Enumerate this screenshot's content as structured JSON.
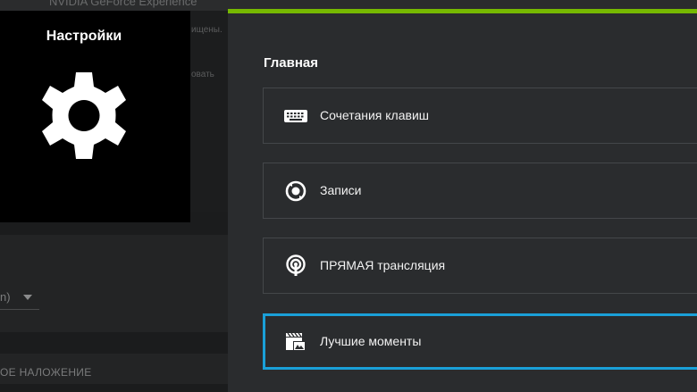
{
  "background": {
    "window_title": "NVIDIA GeForce Experience",
    "text_fragment_1": "ищены.",
    "text_fragment_2": "овать",
    "dropdown_value_fragment": "n)",
    "overlay_section_label": "ОЕ НАЛОЖЕНИЕ"
  },
  "settings_tile": {
    "title": "Настройки",
    "icon": "gear-icon"
  },
  "panel": {
    "accent_color": "#76b900",
    "selected_border_color": "#1aa0d8",
    "section_title": "Главная",
    "items": [
      {
        "label": "Сочетания клавиш",
        "icon": "keyboard-icon",
        "selected": false
      },
      {
        "label": "Записи",
        "icon": "record-icon",
        "selected": false
      },
      {
        "label": "ПРЯМАЯ трансляция",
        "icon": "broadcast-icon",
        "selected": false
      },
      {
        "label": "Лучшие моменты",
        "icon": "highlights-icon",
        "selected": true
      }
    ]
  }
}
